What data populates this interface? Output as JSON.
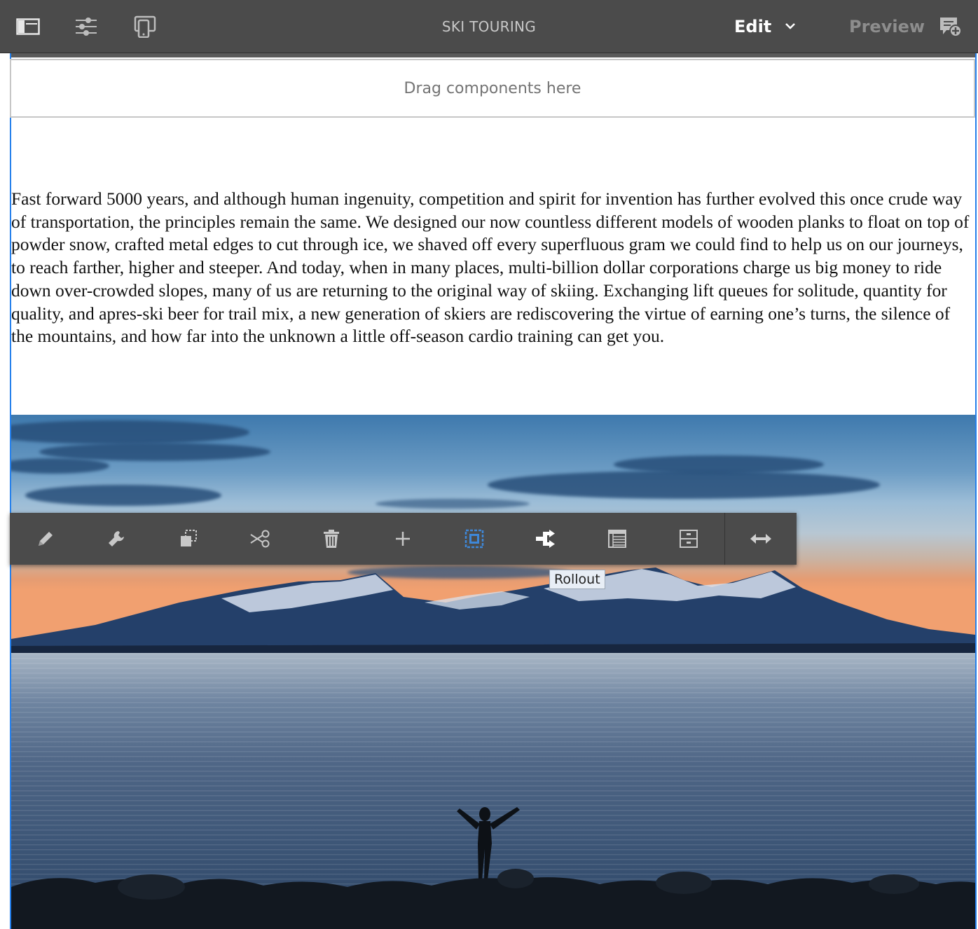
{
  "header": {
    "title": "SKI TOURING",
    "mode_label": "Edit",
    "preview_label": "Preview",
    "left_icons": [
      "side-panel-icon",
      "page-properties-icon",
      "emulator-icon"
    ],
    "right_icon": "annotate-icon"
  },
  "dropzone": {
    "label": "Drag components here"
  },
  "article": {
    "text": "Fast forward 5000 years, and although human ingenuity, competition and spirit for invention has further evolved this once crude way of transportation, the principles remain the same. We designed our now countless different models of wooden planks to float on top of powder snow, crafted metal edges to cut through ice, we shaved off every superfluous gram we could find to help us on our journeys, to reach farther, higher and steeper. And today, when in many places, multi-billion dollar corporations charge us big money to ride down over-crowded slopes, many of us are returning to the original way of skiing. Exchanging lift queues for solitude, quantity for quality, and apres-ski beer for trail mix, a new generation of skiers are rediscovering the virtue of earning one’s turns, the silence of the mountains, and how far into the unknown a little off-season cardio training can get you."
  },
  "component_toolbar": {
    "actions": [
      "edit-icon",
      "configure-icon",
      "copy-icon",
      "cut-icon",
      "delete-icon",
      "insert-icon",
      "parent-icon",
      "rollout-icon",
      "layout-icon",
      "group-icon",
      "resize-icon"
    ],
    "tooltip": "Rollout"
  },
  "colors": {
    "header_bg": "#4b4b4b",
    "toolbar_bg": "#4b4b4b",
    "accent_blue": "#2680eb",
    "selected_icon": "#3e87d8"
  }
}
